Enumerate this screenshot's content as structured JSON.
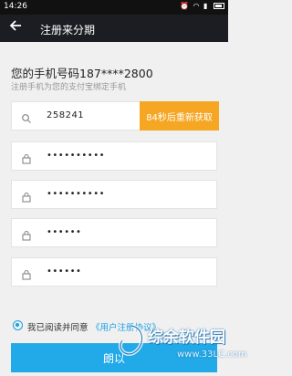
{
  "status_bar": {
    "time": "14:26"
  },
  "app_bar": {
    "title": "注册来分期",
    "back_icon": "arrow-back-icon"
  },
  "header": {
    "phone_label": "您的手机号码187****2800",
    "subtitle": "注册手机为您的支付宝绑定手机"
  },
  "form": {
    "code_value": "258241",
    "code_button": "84秒后重新获取",
    "password1": "••••••••••",
    "password2": "••••••••••",
    "pin1": "••••••",
    "pin2": "••••••"
  },
  "agreement": {
    "text": "我已阅读并同意",
    "link": "《用户注册协议》"
  },
  "next_button": "朗以",
  "watermark": {
    "main": "综余软件园",
    "sub": "www.33LC.com"
  },
  "colors": {
    "accent": "#21a9e8",
    "orange": "#f5a623",
    "appbar": "#1b1d23"
  }
}
